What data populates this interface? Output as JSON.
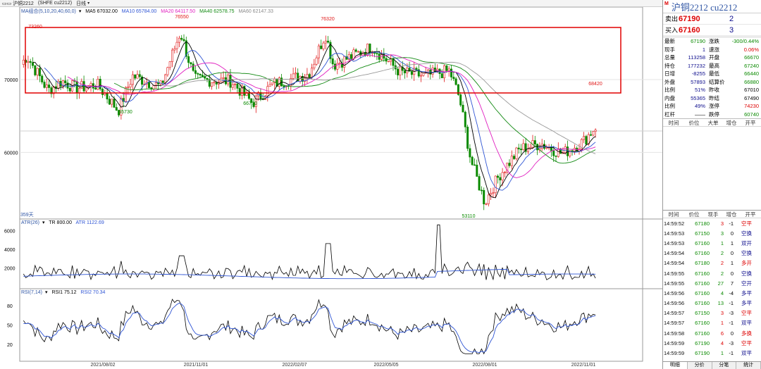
{
  "topbar": {
    "symbol": "沪铜2212",
    "code": "(SHFE cu2212)",
    "period": "日线"
  },
  "ma_bar": {
    "name": "MA组合(5,10,20,40,60,0)",
    "ma5": "MA5 67032.00",
    "ma10": "MA10 65784.00",
    "ma20": "MA20 64117.50",
    "ma40": "MA40 62578.75",
    "ma60": "MA60 62147.33",
    "colors": {
      "ma5": "#000000",
      "ma10": "#2f55d4",
      "ma20": "#e020c0",
      "ma40": "#138a13",
      "ma60": "#9a9a9a"
    }
  },
  "atr_bar": {
    "name": "ATR(26)",
    "tr": "TR 800.00",
    "atr": "ATR 1122.69"
  },
  "rsi_bar": {
    "name": "RSI(7,14)",
    "rsi1": "RSI1 75.12",
    "rsi2": "RSI2 70.34"
  },
  "price_axis": {
    "labels": [
      "70000",
      "60000"
    ]
  },
  "price_annotations": [
    "73260",
    "76550",
    "76320",
    "65730",
    "66770",
    "68420",
    "53110"
  ],
  "days_label": "359天",
  "atr_axis": [
    "6000",
    "4000",
    "2000"
  ],
  "rsi_axis": [
    "80",
    "50",
    "20"
  ],
  "x_axis": [
    "2021/08/02",
    "2021/11/01",
    "2022/02/07",
    "2022/05/05",
    "2022/08/01",
    "2022/11/01"
  ],
  "chart_data": {
    "type": "line",
    "title": "沪铜2212 日线",
    "ylim": [
      52000,
      79000
    ],
    "x": [
      "2021/08/02",
      "2021/11/01",
      "2022/02/07",
      "2022/05/05",
      "2022/08/01",
      "2022/11/01"
    ],
    "series": [
      {
        "name": "MA5",
        "values": [
          69500,
          70200,
          71200,
          72500,
          57500,
          66500
        ]
      },
      {
        "name": "MA20",
        "values": [
          70800,
          70800,
          71300,
          72600,
          59500,
          64100
        ]
      },
      {
        "name": "MA60",
        "values": [
          71500,
          70900,
          71200,
          72800,
          63500,
          62100
        ]
      }
    ],
    "annotations": [
      {
        "label": "73260"
      },
      {
        "label": "76550"
      },
      {
        "label": "76320"
      },
      {
        "label": "65730"
      },
      {
        "label": "66770"
      },
      {
        "label": "68420"
      },
      {
        "label": "53110"
      }
    ]
  },
  "panel": {
    "mark": "M",
    "title": "沪铜2212  cu2212",
    "sell": {
      "label": "卖出",
      "price": "67190",
      "vol": "2"
    },
    "buy": {
      "label": "买入",
      "price": "67160",
      "vol": "3"
    },
    "quote": [
      {
        "k": "最新",
        "v": "67190",
        "vc": "green",
        "k2": "涨跌",
        "v2": "-300/0.44%",
        "v2c": "green"
      },
      {
        "k": "现手",
        "v": "1",
        "vc": "blue",
        "k2": "速涨",
        "v2": "0.06%",
        "v2c": "red"
      },
      {
        "k": "总量",
        "v": "113258",
        "vc": "blue",
        "k2": "开盘",
        "v2": "66670",
        "v2c": "green"
      },
      {
        "k": "持仓",
        "v": "177232",
        "vc": "blue",
        "k2": "最高",
        "v2": "67240",
        "v2c": "green"
      },
      {
        "k": "日增",
        "v": "-8255",
        "vc": "blue",
        "k2": "最低",
        "v2": "66440",
        "v2c": "green"
      },
      {
        "k": "外盘",
        "v": "57893",
        "vc": "blue",
        "k2": "结算价",
        "v2": "66880",
        "v2c": "green"
      },
      {
        "k": "比例",
        "v": "51%",
        "vc": "blue",
        "k2": "昨收",
        "v2": "67010",
        "v2c": ""
      },
      {
        "k": "内盘",
        "v": "55365",
        "vc": "blue",
        "k2": "昨结",
        "v2": "67490",
        "v2c": ""
      },
      {
        "k": "比例",
        "v": "49%",
        "vc": "blue",
        "k2": "涨停",
        "v2": "74230",
        "v2c": "red"
      },
      {
        "k": "杠杆",
        "v": "——",
        "vc": "",
        "k2": "跌停",
        "v2": "60740",
        "v2c": "green"
      }
    ],
    "hdr1": [
      "时间",
      "价位",
      "大单",
      "增仓",
      "开平"
    ],
    "hdr2": [
      "时间",
      "价位",
      "现手",
      "增仓",
      "开平"
    ],
    "trades": [
      {
        "t": "14:59:52",
        "p": "67180",
        "v": "3",
        "vc": "red",
        "c": "-1",
        "x": "空平",
        "xc": "red"
      },
      {
        "t": "14:59:53",
        "p": "67150",
        "v": "3",
        "vc": "green",
        "c": "0",
        "x": "空换",
        "xc": "blue"
      },
      {
        "t": "14:59:53",
        "p": "67160",
        "v": "1",
        "vc": "green",
        "c": "1",
        "x": "双开",
        "xc": "blue"
      },
      {
        "t": "14:59:54",
        "p": "67160",
        "v": "2",
        "vc": "green",
        "c": "0",
        "x": "空换",
        "xc": "blue"
      },
      {
        "t": "14:59:54",
        "p": "67180",
        "v": "2",
        "vc": "red",
        "c": "1",
        "x": "多开",
        "xc": "red"
      },
      {
        "t": "14:59:55",
        "p": "67160",
        "v": "2",
        "vc": "green",
        "c": "0",
        "x": "空换",
        "xc": "blue"
      },
      {
        "t": "14:59:55",
        "p": "67160",
        "v": "27",
        "vc": "green",
        "c": "7",
        "x": "空开",
        "xc": "blue"
      },
      {
        "t": "14:59:56",
        "p": "67160",
        "v": "4",
        "vc": "green",
        "c": "-4",
        "x": "多平",
        "xc": "blue"
      },
      {
        "t": "14:59:56",
        "p": "67160",
        "v": "13",
        "vc": "green",
        "c": "-1",
        "x": "多平",
        "xc": "blue"
      },
      {
        "t": "14:59:57",
        "p": "67150",
        "v": "3",
        "vc": "red",
        "c": "-3",
        "x": "空平",
        "xc": "red"
      },
      {
        "t": "14:59:57",
        "p": "67160",
        "v": "1",
        "vc": "red",
        "c": "-1",
        "x": "双平",
        "xc": "blue"
      },
      {
        "t": "14:59:58",
        "p": "67160",
        "v": "6",
        "vc": "red",
        "c": "0",
        "x": "多换",
        "xc": "red"
      },
      {
        "t": "14:59:59",
        "p": "67190",
        "v": "4",
        "vc": "red",
        "c": "-3",
        "x": "空平",
        "xc": "red"
      },
      {
        "t": "14:59:59",
        "p": "67190",
        "v": "1",
        "vc": "green",
        "c": "-1",
        "x": "双平",
        "xc": "blue"
      }
    ],
    "tabs": [
      "明细",
      "分价",
      "分笔",
      "统计"
    ]
  }
}
